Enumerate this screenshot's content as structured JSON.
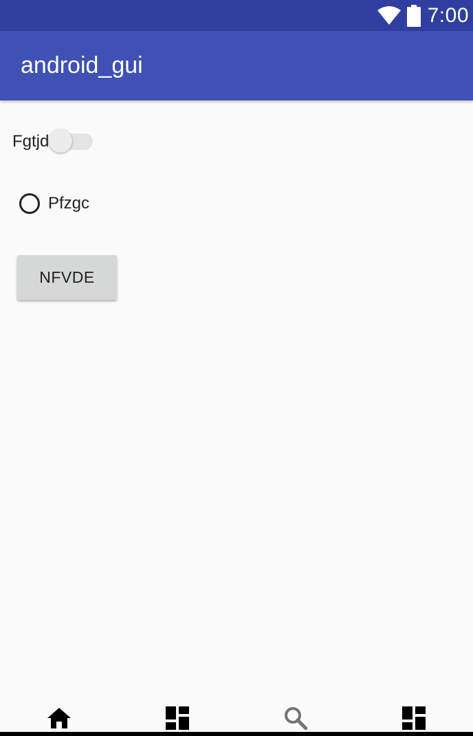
{
  "status_bar": {
    "time": "7:00",
    "wifi_icon": "wifi-icon",
    "battery_icon": "battery-icon",
    "background": "#303f9f"
  },
  "app_bar": {
    "title": "android_gui",
    "background": "#3f51b5"
  },
  "content": {
    "switch": {
      "label": "Fgtjd",
      "checked": false
    },
    "radio": {
      "label": "Pfzgc",
      "checked": false
    },
    "button": {
      "label": "NFVDE"
    }
  },
  "bottom_nav": {
    "items": [
      {
        "icon": "home-icon",
        "active": true
      },
      {
        "icon": "dashboard-icon",
        "active": false
      },
      {
        "icon": "search-icon",
        "active": false
      },
      {
        "icon": "dashboard-icon",
        "active": false
      }
    ]
  }
}
